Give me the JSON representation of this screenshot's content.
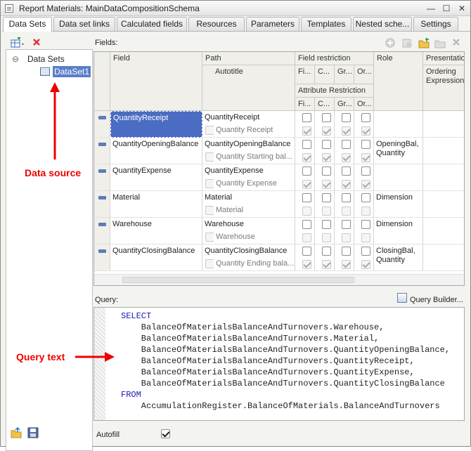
{
  "window": {
    "title": "Report Materials: MainDataCompositionSchema",
    "controls": [
      "—",
      "☐",
      "✕"
    ]
  },
  "tabs": [
    "Data Sets",
    "Data set links",
    "Calculated fields",
    "Resources",
    "Parameters",
    "Templates",
    "Nested sche...",
    "Settings"
  ],
  "tree": {
    "root": "Data Sets",
    "child": "DataSet1",
    "expander": "⊖"
  },
  "fields": {
    "label": "Fields:",
    "headers": {
      "field": "Field",
      "path": "Path",
      "autotitle": "Autotitle",
      "restriction": "Field restriction",
      "attr_restriction": "Attribute Restriction",
      "role": "Role",
      "presentation": "Presentatio...",
      "ordering": "Ordering Expressions",
      "restriction_cols": [
        "Fi...",
        "C...",
        "Gr...",
        "Or..."
      ],
      "attr_cols": [
        "Fi...",
        "C...",
        "Gr...",
        "Or..."
      ]
    },
    "rows": [
      {
        "field": "QuantityReceipt",
        "path": "QuantityReceipt",
        "title": "Quantity Receipt",
        "role": "",
        "restr": [
          false,
          false,
          false,
          false
        ],
        "attr": [
          true,
          true,
          true,
          true
        ]
      },
      {
        "field": "QuantityOpeningBalance",
        "path": "QuantityOpeningBalance",
        "title": "Quantity Starting bal...",
        "role": "OpeningBal, Quantity",
        "restr": [
          false,
          false,
          false,
          false
        ],
        "attr": [
          true,
          true,
          true,
          true
        ]
      },
      {
        "field": "QuantityExpense",
        "path": "QuantityExpense",
        "title": "Quantity Expense",
        "role": "",
        "restr": [
          false,
          false,
          false,
          false
        ],
        "attr": [
          true,
          true,
          true,
          true
        ]
      },
      {
        "field": "Material",
        "path": "Material",
        "title": "Material",
        "role": "Dimension",
        "restr": [
          false,
          false,
          false,
          false
        ],
        "attr": [
          false,
          false,
          false,
          false
        ]
      },
      {
        "field": "Warehouse",
        "path": "Warehouse",
        "title": "Warehouse",
        "role": "Dimension",
        "restr": [
          false,
          false,
          false,
          false
        ],
        "attr": [
          false,
          false,
          false,
          false
        ]
      },
      {
        "field": "QuantityClosingBalance",
        "path": "QuantityClosingBalance",
        "title": "Quantity Ending bala...",
        "role": "ClosingBal, Quantity",
        "restr": [
          false,
          false,
          false,
          false
        ],
        "attr": [
          true,
          true,
          true,
          true
        ]
      }
    ]
  },
  "query": {
    "label": "Query:",
    "builder": "Query Builder...",
    "lines": [
      "SELECT",
      "    BalanceOfMaterialsBalanceAndTurnovers.Warehouse,",
      "    BalanceOfMaterialsBalanceAndTurnovers.Material,",
      "    BalanceOfMaterialsBalanceAndTurnovers.QuantityOpeningBalance,",
      "    BalanceOfMaterialsBalanceAndTurnovers.QuantityReceipt,",
      "    BalanceOfMaterialsBalanceAndTurnovers.QuantityExpense,",
      "    BalanceOfMaterialsBalanceAndTurnovers.QuantityClosingBalance",
      "FROM",
      "    AccumulationRegister.BalanceOfMaterials.BalanceAndTurnovers"
    ]
  },
  "autofill": {
    "label": "Autofill",
    "checked": true
  },
  "annotations": {
    "data_source": "Data source",
    "query_text": "Query text"
  },
  "colors": {
    "accent": "#4a6cc2",
    "annotation": "#e00000"
  }
}
